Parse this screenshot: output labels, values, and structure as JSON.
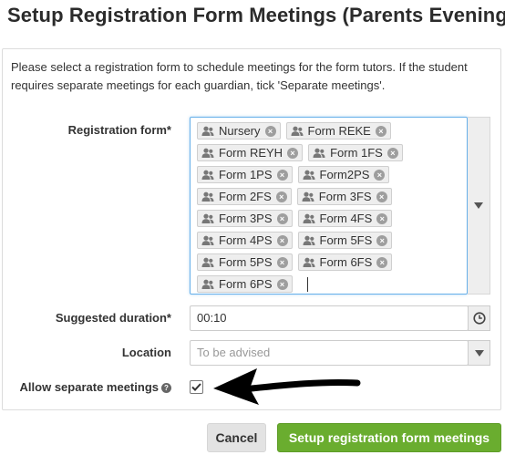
{
  "page": {
    "title": "Setup Registration Form Meetings (Parents Evening)"
  },
  "intro_text": "Please select a registration form to schedule meetings for the form tutors. If the student requires separate meetings for each guardian, tick 'Separate meetings'.",
  "form": {
    "registration_form": {
      "label": "Registration form*",
      "selected": [
        [
          "Nursery",
          "Form REKE"
        ],
        [
          "Form REYH",
          "Form 1FS"
        ],
        [
          "Form 1PS",
          "Form2PS"
        ],
        [
          "Form 2FS",
          "Form 3FS"
        ],
        [
          "Form 3PS",
          "Form 4FS"
        ],
        [
          "Form 4PS",
          "Form 5FS"
        ],
        [
          "Form 5PS",
          "Form 6FS"
        ],
        [
          "Form 6PS"
        ]
      ]
    },
    "suggested_duration": {
      "label": "Suggested duration*",
      "value": "00:10"
    },
    "location": {
      "label": "Location",
      "placeholder": "To be advised"
    },
    "allow_separate": {
      "label": "Allow separate meetings",
      "checked": true
    }
  },
  "buttons": {
    "cancel": "Cancel",
    "submit": "Setup registration form meetings"
  },
  "colors": {
    "primary": "#6aad2f",
    "focus_border": "#66afe9",
    "chip_bg": "#eeeeee"
  }
}
